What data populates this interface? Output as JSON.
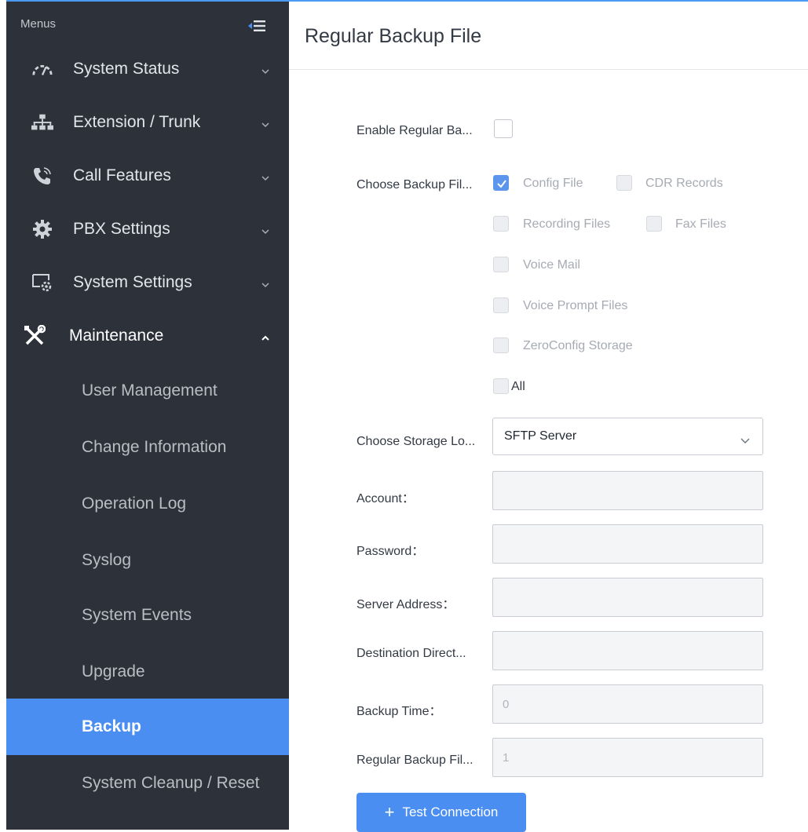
{
  "sidebar": {
    "menus_label": "Menus",
    "items": [
      {
        "label": "System Status",
        "icon": "gauge-icon"
      },
      {
        "label": "Extension / Trunk",
        "icon": "network-icon"
      },
      {
        "label": "Call Features",
        "icon": "phone-icon"
      },
      {
        "label": "PBX Settings",
        "icon": "gear-icon"
      },
      {
        "label": "System Settings",
        "icon": "monitor-gear-icon"
      },
      {
        "label": "Maintenance",
        "icon": "tools-icon"
      }
    ],
    "sub_items": [
      {
        "label": "User Management"
      },
      {
        "label": "Change Information"
      },
      {
        "label": "Operation Log"
      },
      {
        "label": "Syslog"
      },
      {
        "label": "System Events"
      },
      {
        "label": "Upgrade"
      },
      {
        "label": "Backup",
        "active": true
      },
      {
        "label": "System Cleanup / Reset"
      }
    ]
  },
  "main": {
    "title": "Regular Backup File",
    "enable_label": "Enable Regular Ba...",
    "enable_checked": false,
    "choose_files_label": "Choose Backup Fil...",
    "file_options": [
      {
        "label": "Config File",
        "checked": true
      },
      {
        "label": "CDR Records",
        "checked": false
      },
      {
        "label": "Recording Files",
        "checked": false
      },
      {
        "label": "Fax Files",
        "checked": false
      },
      {
        "label": "Voice Mail",
        "checked": false
      },
      {
        "label": "Voice Prompt Files",
        "checked": false
      },
      {
        "label": "ZeroConfig Storage",
        "checked": false
      },
      {
        "label": "All",
        "checked": false
      }
    ],
    "storage_label": "Choose Storage Lo...",
    "storage_value": "SFTP Server",
    "account_label": "Account：",
    "account_value": "",
    "password_label": "Password：",
    "password_value": "",
    "server_label": "Server Address：",
    "server_value": "",
    "dest_label": "Destination Direct...",
    "dest_value": "",
    "backup_time_label": "Backup Time：",
    "backup_time_value": "0",
    "regular_label": "Regular Backup Fil...",
    "regular_value": "1",
    "test_button_label": "Test Connection"
  },
  "colors": {
    "sidebar_bg": "#2d323a",
    "accent": "#4a8ef2"
  }
}
